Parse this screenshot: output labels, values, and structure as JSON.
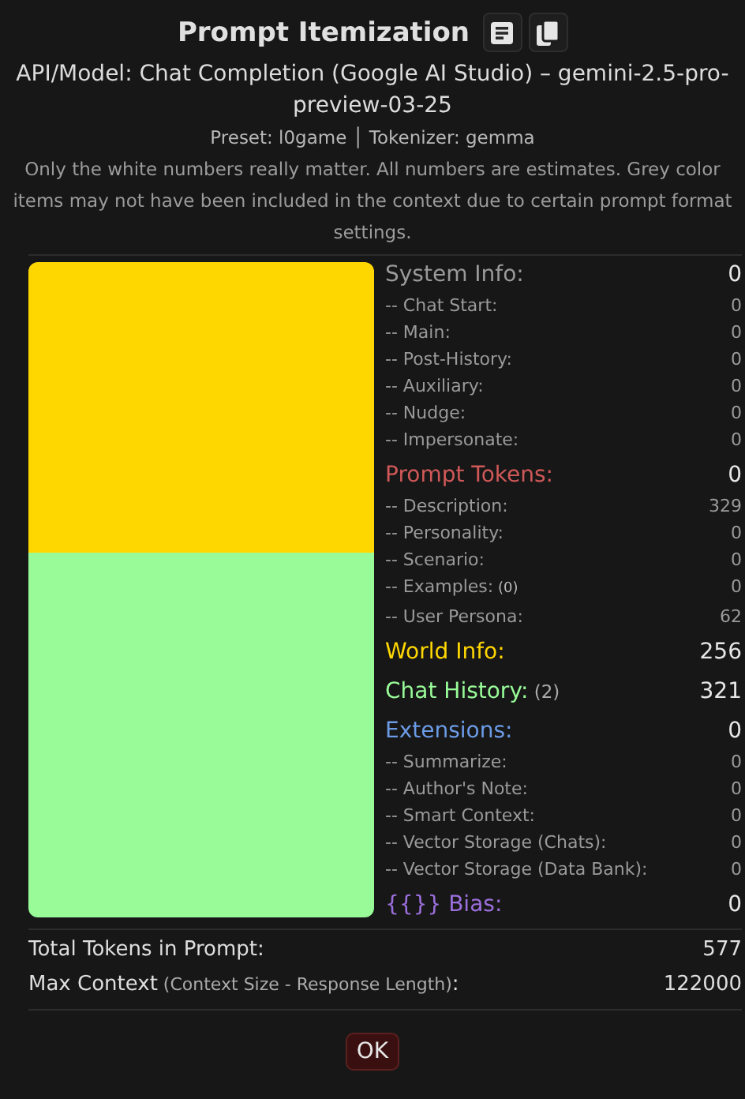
{
  "title": "Prompt Itemization",
  "model_line": "API/Model: Chat Completion (Google AI Studio) – gemini-2.5-pro-preview-03-25",
  "preset_line": "Preset: l0game │ Tokenizer: gemma",
  "note": "Only the white numbers really matter. All numbers are estimates. Grey color items may not have been included in the context due to certain prompt format settings.",
  "sections": [
    {
      "label": "System Info:",
      "color": "#9a9a9a",
      "value": "0",
      "items": [
        {
          "label": "-- Chat Start:",
          "value": "0"
        },
        {
          "label": "-- Main:",
          "value": "0"
        },
        {
          "label": "-- Post-History:",
          "value": "0"
        },
        {
          "label": "-- Auxiliary:",
          "value": "0"
        },
        {
          "label": "-- Nudge:",
          "value": "0"
        },
        {
          "label": "-- Impersonate:",
          "value": "0"
        }
      ]
    },
    {
      "label": "Prompt Tokens:",
      "color": "#d05858",
      "value": "0",
      "items": [
        {
          "label": "-- Description:",
          "value": "329"
        },
        {
          "label": "-- Personality:",
          "value": "0"
        },
        {
          "label": "-- Scenario:",
          "value": "0"
        },
        {
          "label": "-- Examples:",
          "note": "(0)",
          "value": "0"
        },
        {
          "label": "-- User Persona:",
          "value": "62"
        }
      ]
    },
    {
      "label": "World Info:",
      "color": "#ffd700",
      "value": "256"
    },
    {
      "label": "Chat History:",
      "note": "(2)",
      "color": "#98fb98",
      "value": "321"
    },
    {
      "label": "Extensions:",
      "color": "#6c9be6",
      "value": "0",
      "items": [
        {
          "label": "-- Summarize:",
          "value": "0"
        },
        {
          "label": "-- Author's Note:",
          "value": "0"
        },
        {
          "label": "-- Smart Context:",
          "value": "0"
        },
        {
          "label": "-- Vector Storage (Chats):",
          "value": "0"
        },
        {
          "label": "-- Vector Storage (Data Bank):",
          "value": "0"
        }
      ]
    },
    {
      "label": "{{}} Bias:",
      "color": "#9b6fdc",
      "value": "0"
    }
  ],
  "totals": [
    {
      "label": "Total Tokens in Prompt:",
      "value": "577"
    },
    {
      "label": "Max Context",
      "note": "(Context Size - Response Length)",
      "tail": ":",
      "value": "122000"
    }
  ],
  "button": "OK"
}
